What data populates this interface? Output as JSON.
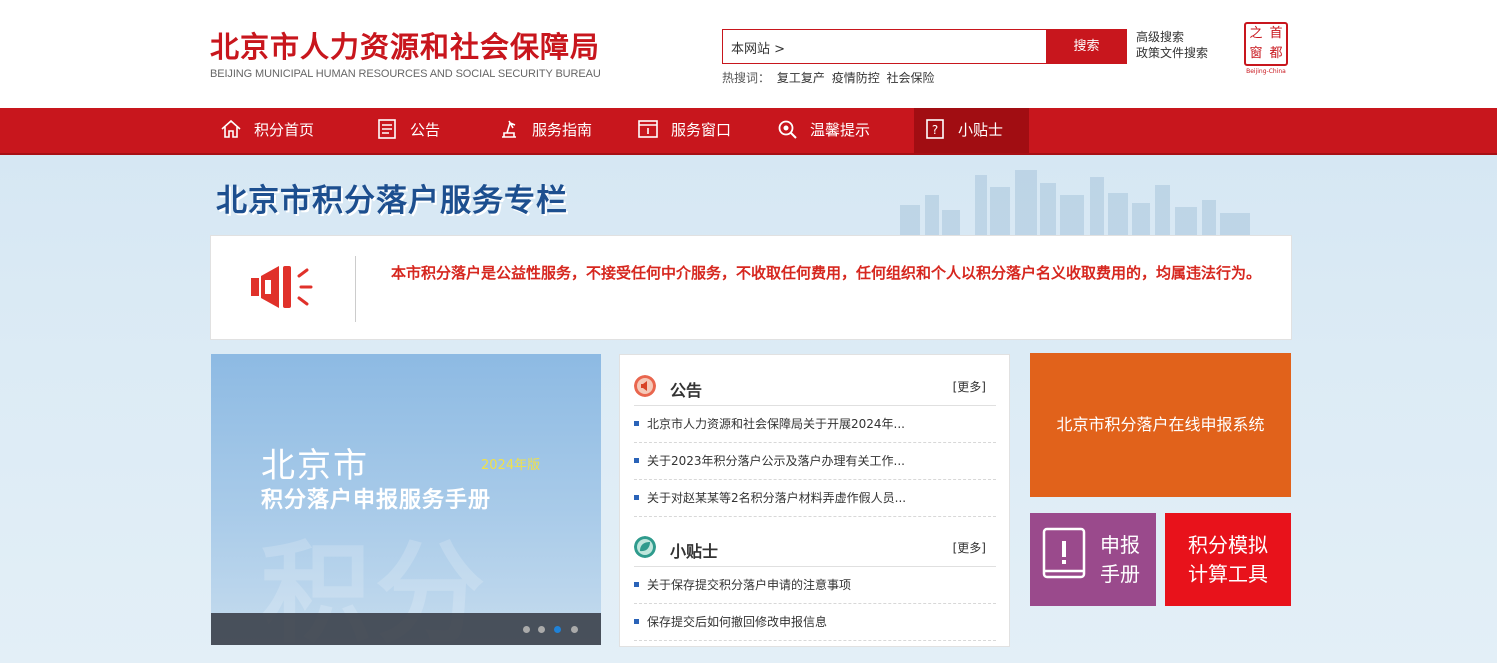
{
  "header": {
    "logo_cn": "北京市人力资源和社会保障局",
    "logo_en": "BEIJING MUNICIPAL HUMAN RESOURCES AND SOCIAL SECURITY BUREAU",
    "search_scope": "本网站 >",
    "search_button": "搜索",
    "advanced_search": "高级搜索",
    "policy_search": "政策文件搜索",
    "hot_label": "热搜词：",
    "hot_words": [
      "复工复产",
      "疫情防控",
      "社会保险"
    ],
    "seal_chars": [
      "之",
      "首",
      "窗",
      "都"
    ],
    "seal_caption": "Beijing-China"
  },
  "nav": {
    "items": [
      {
        "label": "积分首页",
        "icon": "home-icon"
      },
      {
        "label": "公告",
        "icon": "notice-icon"
      },
      {
        "label": "服务指南",
        "icon": "guide-icon"
      },
      {
        "label": "服务窗口",
        "icon": "window-icon"
      },
      {
        "label": "温馨提示",
        "icon": "tip-search-icon"
      },
      {
        "label": "小贴士",
        "icon": "question-icon",
        "active": true
      }
    ]
  },
  "banner": {
    "title": "北京市积分落户服务专栏"
  },
  "notice": {
    "text": "本市积分落户是公益性服务，不接受任何中介服务，不收取任何费用，任何组织和个人以积分落户名义收取费用的，均属违法行为。"
  },
  "slider": {
    "line1": "北京市",
    "year": "2024年版",
    "line2": "积分落户申报服务手册",
    "watermark": "积分",
    "active_slide": 3,
    "slide_count": 4
  },
  "news": {
    "announcements": {
      "title": "公告",
      "more": "[更多]",
      "items": [
        "北京市人力资源和社会保障局关于开展2024年...",
        "关于2023年积分落户公示及落户办理有关工作...",
        "关于对赵某某等2名积分落户材料弄虚作假人员..."
      ]
    },
    "tips": {
      "title": "小贴士",
      "more": "[更多]",
      "items": [
        "关于保存提交积分落户申请的注意事项",
        "保存提交后如何撤回修改申报信息"
      ]
    }
  },
  "tiles": {
    "online_system": "北京市积分落户在线申报系统",
    "manual": [
      "申报",
      "手册"
    ],
    "calculator": [
      "积分模拟",
      "计算工具"
    ]
  },
  "colors": {
    "brand_red": "#c8161d",
    "title_blue": "#1d4f8f",
    "orange": "#e1621b",
    "purple": "#9a4a8c",
    "red_tile": "#e8121b"
  }
}
